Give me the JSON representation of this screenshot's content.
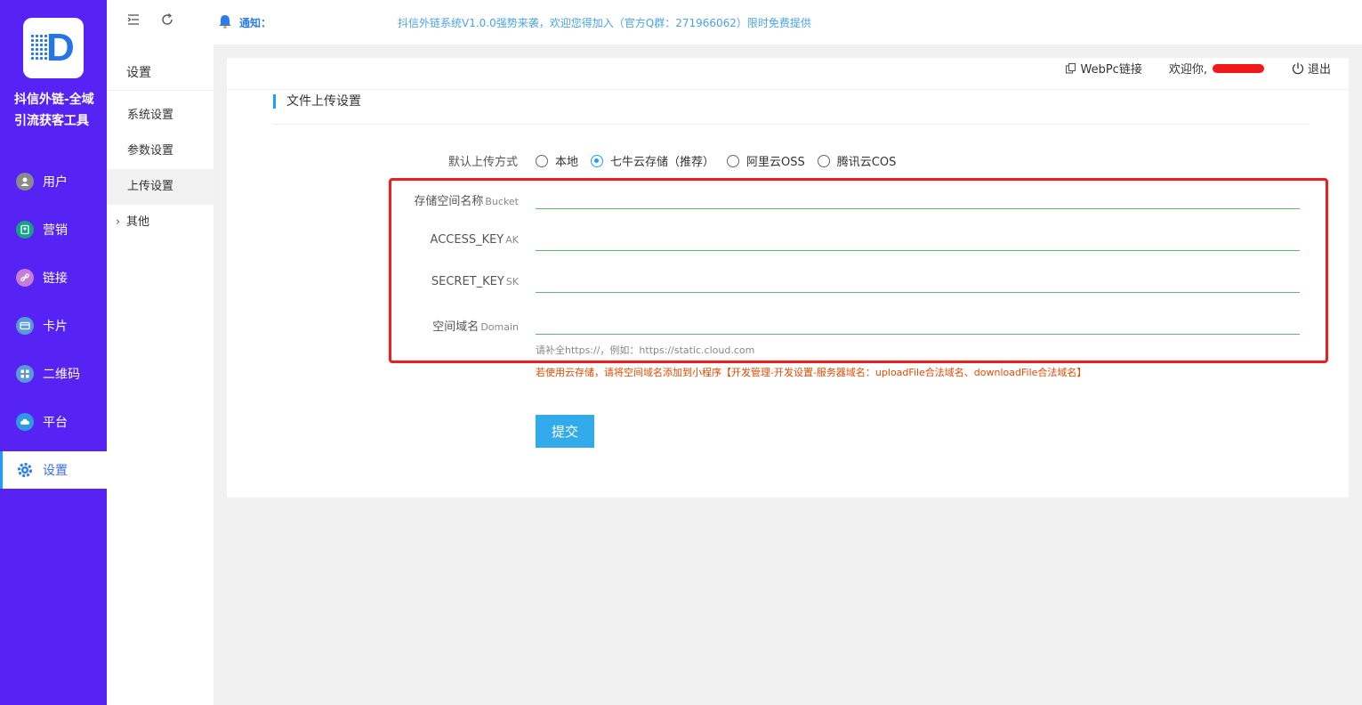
{
  "app": {
    "logo_letter": "D",
    "title": "抖信外链-全域引流获客工具"
  },
  "sidebar": {
    "items": [
      {
        "label": "用户",
        "icon": "user-icon",
        "color": "#8a8a8a"
      },
      {
        "label": "营销",
        "icon": "marketing-icon",
        "color": "#16a085"
      },
      {
        "label": "链接",
        "icon": "link-icon",
        "color": "#c77dd6"
      },
      {
        "label": "卡片",
        "icon": "card-icon",
        "color": "#5b9bd5"
      },
      {
        "label": "二维码",
        "icon": "qrcode-icon",
        "color": "#5b9bd5"
      },
      {
        "label": "平台",
        "icon": "cloud-icon",
        "color": "#2f9ae0"
      },
      {
        "label": "设置",
        "icon": "gear-icon",
        "color": "#2f7be8",
        "active": true
      }
    ]
  },
  "submenu": {
    "title": "设置",
    "items": [
      {
        "label": "系统设置"
      },
      {
        "label": "参数设置"
      },
      {
        "label": "上传设置",
        "active": true
      }
    ],
    "more_label": "其他"
  },
  "notice": {
    "label": "通知：",
    "text": "抖信外链系统V1.0.0强势来袭，欢迎您得加入（官方Q群：271966062）限时免费提供"
  },
  "user_bar": {
    "webpc_label": "WebPc链接",
    "welcome_label": "欢迎你,",
    "logout_label": "退出"
  },
  "form": {
    "section_title": "文件上传设置",
    "upload_method_label": "默认上传方式",
    "upload_options": [
      {
        "label": "本地",
        "checked": false
      },
      {
        "label": "七牛云存储（推荐）",
        "checked": true
      },
      {
        "label": "阿里云OSS",
        "checked": false
      },
      {
        "label": "腾讯云COS",
        "checked": false
      }
    ],
    "fields": [
      {
        "label": "存储空间名称",
        "hint": "Bucket",
        "value": ""
      },
      {
        "label": "ACCESS_KEY",
        "hint": "AK",
        "value": ""
      },
      {
        "label": "SECRET_KEY",
        "hint": "SK",
        "value": ""
      },
      {
        "label": "空间域名",
        "hint": "Domain",
        "value": ""
      }
    ],
    "helper_text": "请补全https://，例如：https://static.cloud.com",
    "warning_text": "若使用云存储，请将空间域名添加到小程序【开发管理-开发设置-服务器域名：uploadFile合法域名、downloadFile合法域名】",
    "submit_label": "提交"
  },
  "colors": {
    "sidebar_bg": "#5722f4",
    "accent": "#1e9fff",
    "submit_bg": "#33abeb",
    "highlight_border": "#f01d1d",
    "warning": "#e64a00",
    "field_underline": "#5fb878"
  }
}
